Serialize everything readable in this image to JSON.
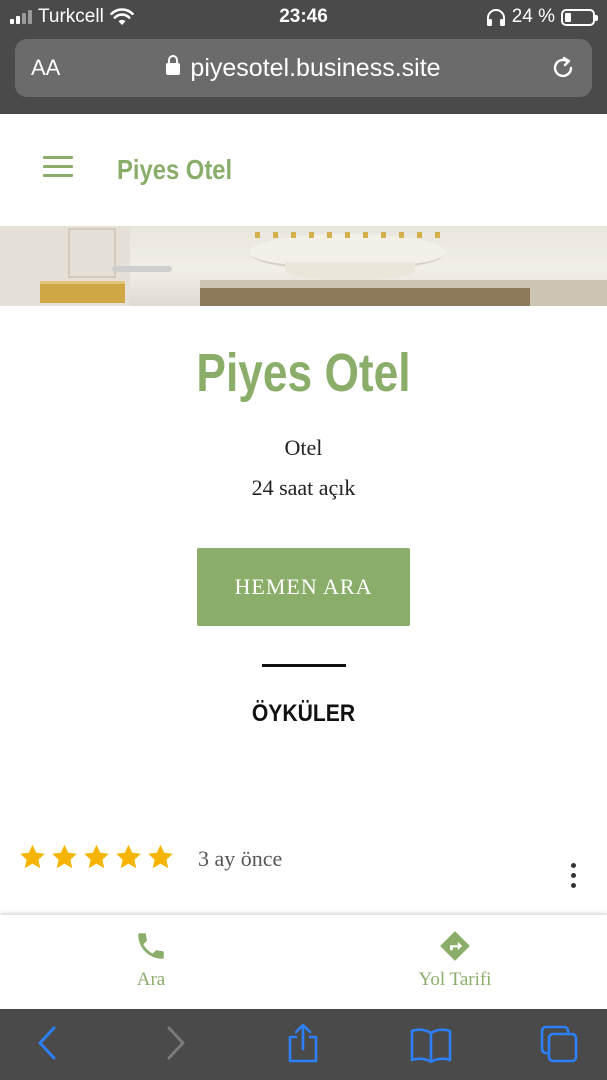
{
  "status_bar": {
    "carrier": "Turkcell",
    "time": "23:46",
    "battery_percent": "24 %"
  },
  "browser": {
    "text_size_label": "AA",
    "url": "piyesotel.business.site"
  },
  "header": {
    "brand": "Piyes Otel"
  },
  "main": {
    "title": "Piyes Otel",
    "category": "Otel",
    "hours": "24 saat açık",
    "call_button": "HEMEN ARA",
    "section_title": "ÖYKÜLER"
  },
  "review": {
    "rating": 5,
    "max_rating": 5,
    "time": "3 ay önce"
  },
  "actions": {
    "call_label": "Ara",
    "directions_label": "Yol Tarifi"
  },
  "colors": {
    "accent": "#8aae6a",
    "chrome": "#4a4a4a",
    "star": "#f5b400",
    "safari_blue": "#2d7ff9"
  },
  "icons": {
    "menu": "hamburger-icon",
    "lock": "lock-icon",
    "reload": "reload-icon",
    "call": "phone-icon",
    "directions": "directions-icon",
    "more": "more-vertical-icon"
  }
}
